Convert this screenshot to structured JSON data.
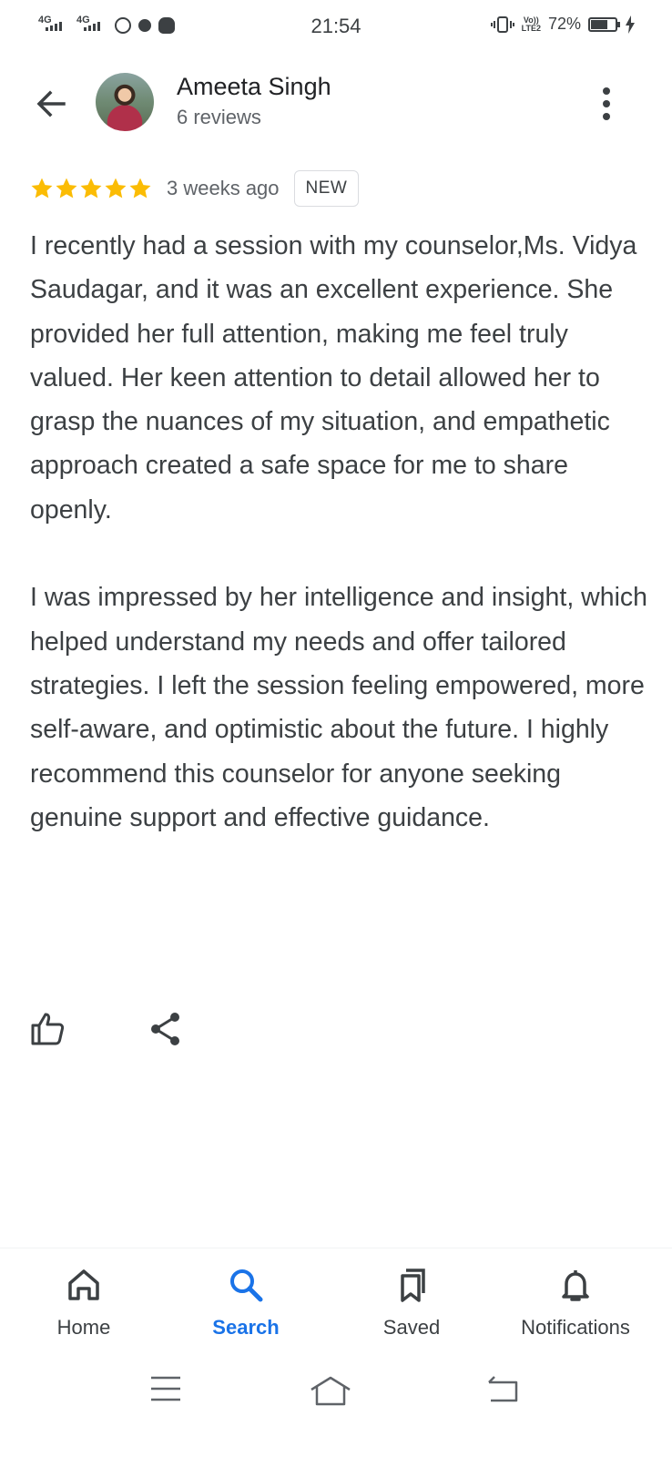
{
  "status_bar": {
    "net1": "4G",
    "net2": "4G",
    "time": "21:54",
    "volte_top": "Vo))",
    "volte_bottom": "LTE2",
    "battery_percent_text": "72%",
    "battery_level": 0.72
  },
  "header": {
    "back_icon": "arrow-left-icon",
    "author_name": "Ameeta Singh",
    "author_reviews": "6 reviews",
    "more_icon": "more-vert-icon"
  },
  "review": {
    "rating": 5,
    "star_color": "#fbbc04",
    "time_ago": "3 weeks ago",
    "badge": "NEW",
    "paragraph1": "I recently had a session with my counselor,Ms. Vidya Saudagar, and it was an excellent experience. She provided her full attention, making me feel truly valued. Her keen attention to detail allowed her to grasp the nuances of my situation, and empathetic approach created a safe space for me to share openly.",
    "paragraph2": "I was impressed by her intelligence and insight, which helped understand my needs and offer tailored strategies. I left the session feeling empowered, more self-aware, and optimistic about the future. I highly recommend this counselor for anyone seeking genuine support and effective guidance."
  },
  "actions": {
    "like_icon": "thumb-up-icon",
    "share_icon": "share-icon"
  },
  "bottom_nav": {
    "active_color": "#1a73e8",
    "tabs": [
      {
        "label": "Home",
        "icon": "home-icon"
      },
      {
        "label": "Search",
        "icon": "search-icon"
      },
      {
        "label": "Saved",
        "icon": "bookmarks-icon"
      },
      {
        "label": "Notifications",
        "icon": "bell-icon"
      }
    ]
  },
  "system_nav": {
    "menu_icon": "menu-icon",
    "home_icon": "system-home-icon",
    "back_icon": "system-back-icon"
  }
}
